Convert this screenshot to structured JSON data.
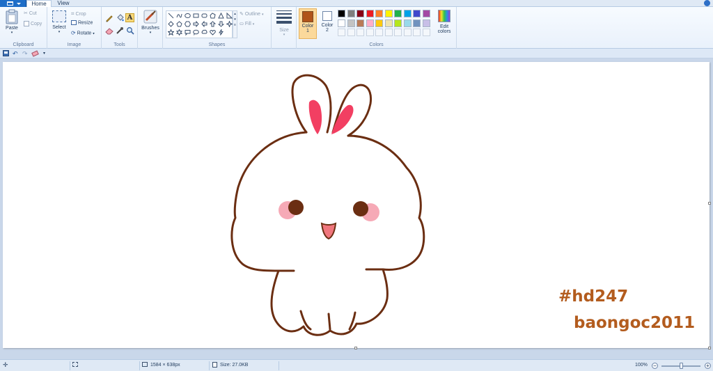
{
  "tabs": {
    "home": "Home",
    "view": "View"
  },
  "clipboard": {
    "paste": "Paste",
    "cut": "Cut",
    "copy": "Copy",
    "group": "Clipboard"
  },
  "image": {
    "select": "Select",
    "crop": "Crop",
    "resize": "Resize",
    "rotate": "Rotate",
    "group": "Image"
  },
  "tools": {
    "group": "Tools"
  },
  "brushes": {
    "label": "Brushes"
  },
  "shapes": {
    "outline": "Outline",
    "fill": "Fill",
    "group": "Shapes"
  },
  "size": {
    "label": "Size"
  },
  "color1": {
    "label": "Color",
    "num": "1",
    "value": "#b0541a"
  },
  "color2": {
    "label": "Color",
    "num": "2",
    "value": "#ffffff"
  },
  "colors": {
    "group": "Colors",
    "palette_row1": [
      "#000000",
      "#7f7f7f",
      "#880015",
      "#ed1c24",
      "#ff7f27",
      "#fff200",
      "#22b14c",
      "#00a2e8",
      "#3f48cc",
      "#a349a4"
    ],
    "palette_row2": [
      "#ffffff",
      "#c3c3c3",
      "#b97a57",
      "#ffaec9",
      "#ffc90e",
      "#efe4b0",
      "#b5e61d",
      "#99d9ea",
      "#7092be",
      "#c8bfe7"
    ],
    "edit_line1": "Edit",
    "edit_line2": "colors"
  },
  "canvas": {
    "watermark_line1": "#hd247",
    "watermark_line2": "baongoc2011"
  },
  "status": {
    "dimensions": "1584 × 638px",
    "size": "Size: 27.0KB",
    "zoom": "100%"
  }
}
